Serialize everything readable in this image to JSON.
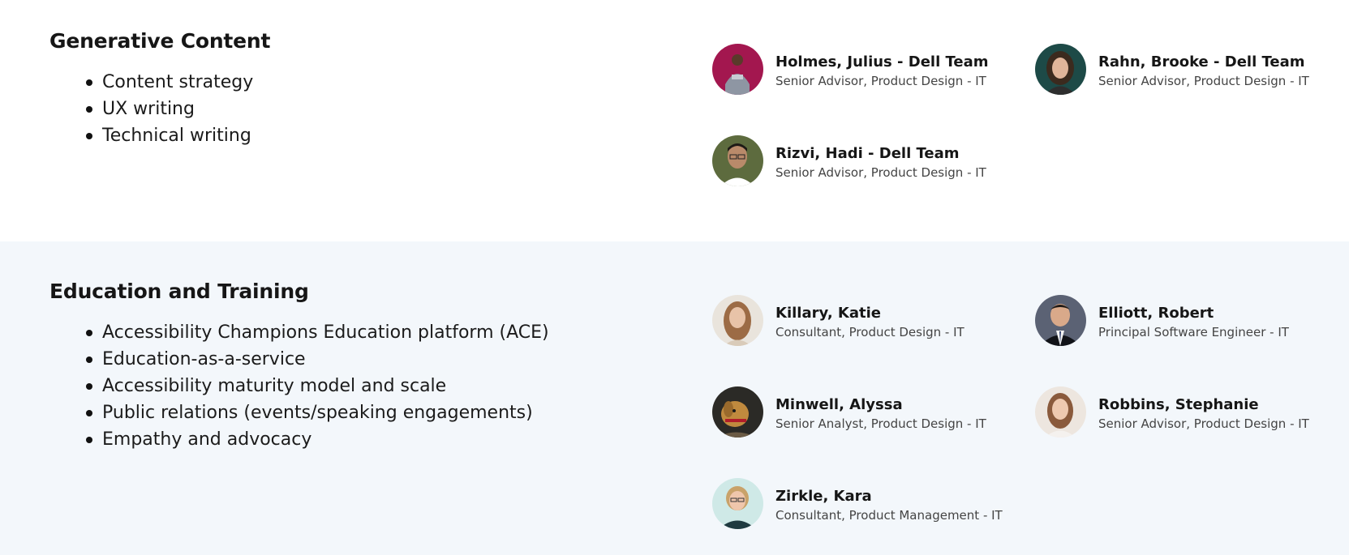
{
  "sections": [
    {
      "title": "Generative Content",
      "topics": [
        "Content strategy",
        "UX writing",
        "Technical writing"
      ],
      "people": [
        {
          "name": "Holmes, Julius - Dell Team",
          "title": "Senior Advisor, Product Design - IT",
          "avatar_bg": "#a3174f"
        },
        {
          "name": "Rahn, Brooke - Dell Team",
          "title": "Senior Advisor, Product Design - IT",
          "avatar_bg": "#1d4a47"
        },
        {
          "name": "Rizvi, Hadi - Dell Team",
          "title": "Senior Advisor, Product Design - IT",
          "avatar_bg": "#5d6b3e"
        }
      ]
    },
    {
      "title": "Education and Training",
      "topics": [
        "Accessibility Champions Education platform (ACE)",
        "Education-as-a-service",
        "Accessibility maturity model and scale",
        "Public relations (events/speaking engagements)",
        "Empathy and advocacy"
      ],
      "people": [
        {
          "name": "Killary, Katie",
          "title": "Consultant, Product Design - IT",
          "avatar_bg": "#e9e4dc"
        },
        {
          "name": "Elliott, Robert",
          "title": "Principal Software Engineer - IT",
          "avatar_bg": "#5b6274"
        },
        {
          "name": "Minwell, Alyssa",
          "title": "Senior Analyst, Product Design - IT",
          "avatar_bg": "#2b2a26"
        },
        {
          "name": "Robbins, Stephanie",
          "title": "Senior Advisor, Product Design - IT",
          "avatar_bg": "#ede6df"
        },
        {
          "name": "Zirkle, Kara",
          "title": "Consultant, Product Management - IT",
          "avatar_bg": "#cfe9e7"
        }
      ]
    }
  ]
}
